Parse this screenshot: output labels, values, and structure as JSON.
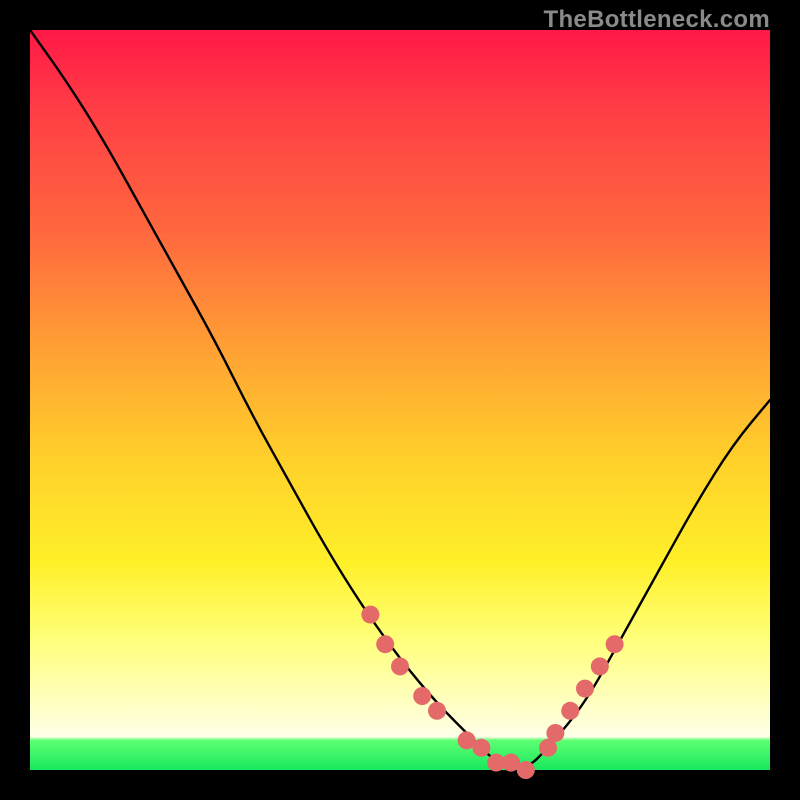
{
  "watermark": "TheBottleneck.com",
  "chart_data": {
    "type": "line",
    "title": "",
    "xlabel": "",
    "ylabel": "",
    "xlim": [
      0,
      100
    ],
    "ylim": [
      0,
      100
    ],
    "grid": false,
    "series": [
      {
        "name": "bottleneck-curve",
        "x": [
          0,
          5,
          10,
          15,
          20,
          25,
          30,
          35,
          40,
          45,
          50,
          55,
          60,
          63,
          67,
          70,
          75,
          80,
          85,
          90,
          95,
          100
        ],
        "values": [
          100,
          93,
          85,
          76,
          67,
          58,
          48,
          39,
          30,
          22,
          15,
          9,
          4,
          1,
          0,
          3,
          9,
          18,
          27,
          36,
          44,
          50
        ]
      }
    ],
    "markers": {
      "name": "highlight-dots",
      "color": "#e46a6a",
      "x": [
        46,
        48,
        50,
        53,
        55,
        59,
        61,
        63,
        65,
        67,
        70,
        71,
        73,
        75,
        77,
        79
      ],
      "values": [
        21,
        17,
        14,
        10,
        8,
        4,
        3,
        1,
        1,
        0,
        3,
        5,
        8,
        11,
        14,
        17
      ]
    }
  },
  "colors": {
    "curve_stroke": "#000000",
    "marker_fill": "#e46a6a",
    "frame_border": "#000000"
  }
}
